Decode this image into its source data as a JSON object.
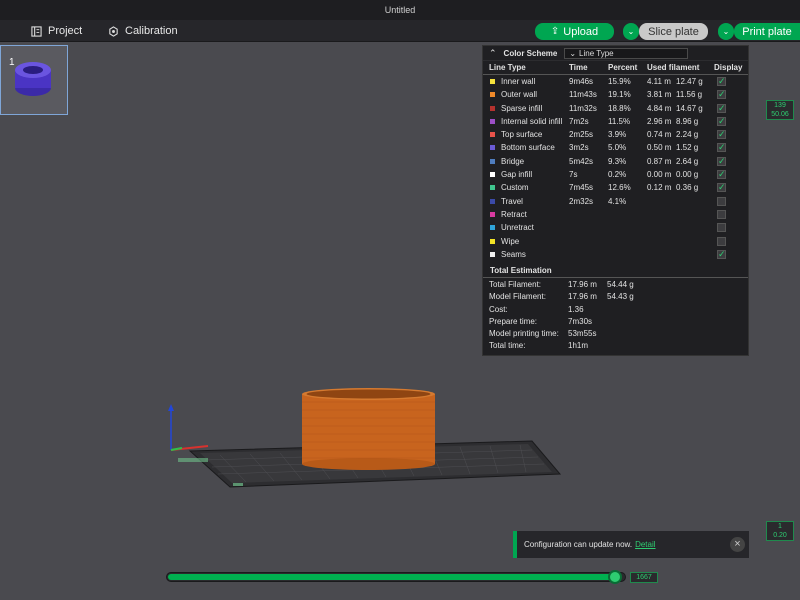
{
  "window": {
    "title": "Untitled"
  },
  "toolbar": {
    "project_label": "Project",
    "calibration_label": "Calibration",
    "upload_label": "Upload",
    "slice_plate_label": "Slice plate",
    "print_plate_label": "Print plate"
  },
  "plate": {
    "number": "1"
  },
  "stats": {
    "color_scheme_label": "Color Scheme",
    "color_scheme_value": "Line Type",
    "headers": {
      "line_type": "Line Type",
      "time": "Time",
      "percent": "Percent",
      "used_filament": "Used filament",
      "display": "Display"
    },
    "rows": [
      {
        "name": "Inner wall",
        "color": "#f5e23c",
        "time": "9m46s",
        "percent": "15.9%",
        "meters": "4.11 m",
        "grams": "12.47 g",
        "display": true
      },
      {
        "name": "Outer wall",
        "color": "#f08a2a",
        "time": "11m43s",
        "percent": "19.1%",
        "meters": "3.81 m",
        "grams": "11.56 g",
        "display": true
      },
      {
        "name": "Sparse infill",
        "color": "#b5322e",
        "time": "11m32s",
        "percent": "18.8%",
        "meters": "4.84 m",
        "grams": "14.67 g",
        "display": true
      },
      {
        "name": "Internal solid infill",
        "color": "#9c4fc7",
        "time": "7m2s",
        "percent": "11.5%",
        "meters": "2.96 m",
        "grams": "8.96 g",
        "display": true
      },
      {
        "name": "Top surface",
        "color": "#e8524a",
        "time": "2m25s",
        "percent": "3.9%",
        "meters": "0.74 m",
        "grams": "2.24 g",
        "display": true
      },
      {
        "name": "Bottom surface",
        "color": "#6a5bd6",
        "time": "3m2s",
        "percent": "5.0%",
        "meters": "0.50 m",
        "grams": "1.52 g",
        "display": true
      },
      {
        "name": "Bridge",
        "color": "#4f7dbf",
        "time": "5m42s",
        "percent": "9.3%",
        "meters": "0.87 m",
        "grams": "2.64 g",
        "display": true
      },
      {
        "name": "Gap infill",
        "color": "#ffffff",
        "time": "7s",
        "percent": "0.2%",
        "meters": "0.00 m",
        "grams": "0.00 g",
        "display": true
      },
      {
        "name": "Custom",
        "color": "#3fc58e",
        "time": "7m45s",
        "percent": "12.6%",
        "meters": "0.12 m",
        "grams": "0.36 g",
        "display": true
      },
      {
        "name": "Travel",
        "color": "#3b4aa8",
        "time": "2m32s",
        "percent": "4.1%",
        "meters": "",
        "grams": "",
        "display": false
      },
      {
        "name": "Retract",
        "color": "#d83aa0",
        "time": "",
        "percent": "",
        "meters": "",
        "grams": "",
        "display": false
      },
      {
        "name": "Unretract",
        "color": "#2fa3d8",
        "time": "",
        "percent": "",
        "meters": "",
        "grams": "",
        "display": false
      },
      {
        "name": "Wipe",
        "color": "#f2e326",
        "time": "",
        "percent": "",
        "meters": "",
        "grams": "",
        "display": false
      },
      {
        "name": "Seams",
        "color": "#f0f0f0",
        "time": "",
        "percent": "",
        "meters": "",
        "grams": "",
        "display": true
      }
    ],
    "estimation_title": "Total Estimation",
    "estimation": [
      {
        "label": "Total Filament:",
        "v1": "17.96 m",
        "v2": "54.44 g"
      },
      {
        "label": "Model Filament:",
        "v1": "17.96 m",
        "v2": "54.43 g"
      },
      {
        "label": "Cost:",
        "v1": "1.36",
        "v2": ""
      },
      {
        "label": "Prepare time:",
        "v1": "7m30s",
        "v2": ""
      },
      {
        "label": "Model printing time:",
        "v1": "53m55s",
        "v2": ""
      },
      {
        "label": "Total time:",
        "v1": "1h1m",
        "v2": ""
      }
    ]
  },
  "layers": {
    "top_layer": "139",
    "top_height": "50.06",
    "bottom_layer": "1",
    "bottom_height": "0.20"
  },
  "notification": {
    "message": "Configuration can update now.",
    "link": "Detail"
  },
  "move_slider": {
    "value": "1667",
    "fraction": 0.98
  },
  "colors": {
    "accent": "#00a651",
    "print_orange": "#c8641e",
    "plate_bg": "#4a4a4f"
  }
}
